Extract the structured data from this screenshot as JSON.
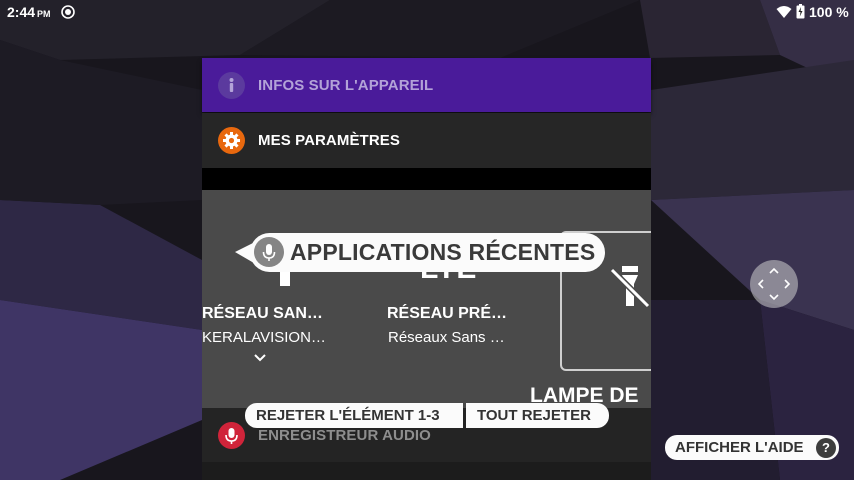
{
  "status_bar": {
    "time": "2:44",
    "time_suffix": "PM",
    "battery_percent": "100 %",
    "icons": [
      "notification-dot-icon",
      "wifi-icon",
      "battery-charging-icon"
    ]
  },
  "recents": {
    "cards": {
      "device_info": {
        "title": "INFOS SUR L'APPAREIL",
        "icon": "info-icon",
        "color": "#4a1b9a"
      },
      "my_settings": {
        "title": "MES PARAMÈTRES",
        "icon": "gear-icon",
        "color": "#e8680e"
      },
      "audio_recorder": {
        "title": "ENREGISTREUR AUDIO",
        "icon": "mic-icon",
        "color": "#d0243a"
      }
    },
    "tiles": {
      "wifi": {
        "title": "RÉSEAU SAN…",
        "subtitle": "KERALAVISION…",
        "icon": "wifi-tile-icon"
      },
      "mobile": {
        "title": "RÉSEAU PRÉ…",
        "subtitle": "Réseaux Sans …",
        "glyph": "LTE"
      },
      "flashlight": {
        "title": "LAMPE DE",
        "icon": "flashlight-off-icon"
      }
    }
  },
  "voice_bubble": {
    "text": "APPLICATIONS RÉCENTES",
    "icon": "mic-icon"
  },
  "actions": {
    "reject_one": "REJETER L'ÉLÉMENT 1-3",
    "reject_all": "TOUT REJETER",
    "show_help": "AFFICHER L'AIDE",
    "help_badge": "?"
  },
  "colors": {
    "accent_purple": "#4a1b9a",
    "settings_orange": "#e8680e",
    "recorder_red": "#d0243a",
    "chip_background": "#fbfbfb"
  }
}
